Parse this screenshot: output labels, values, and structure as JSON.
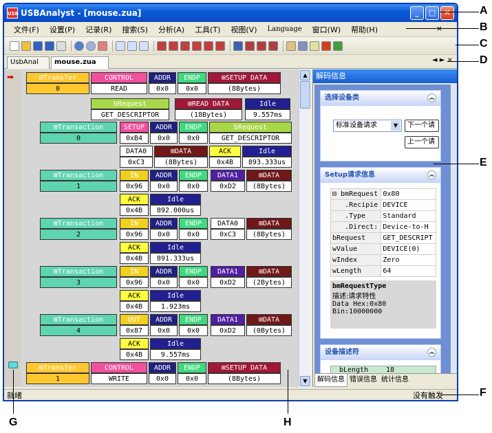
{
  "window": {
    "title": "USBAnalyst - [mouse.zua]",
    "logo": "USB"
  },
  "menu": [
    "文件(F)",
    "设置(P)",
    "记录(R)",
    "搜索(S)",
    "分析(A)",
    "工具(T)",
    "视图(V)",
    "Language",
    "窗口(W)",
    "帮助(H)"
  ],
  "menu_close": "×",
  "tabs": [
    "UsbAnal",
    "mouse.zua"
  ],
  "tab_nav": "◄ ► ×",
  "gutter": {
    "arrow": "➡"
  },
  "rows": [
    {
      "k": "t0_label",
      "text": "Transfer"
    },
    {
      "k": "t0_num",
      "text": "0"
    },
    {
      "k": "t0_ctrl",
      "text": "CONTROL"
    },
    {
      "k": "t0_read",
      "text": "READ"
    },
    {
      "k": "t0_addr",
      "text": "ADDR"
    },
    {
      "k": "t0_addr_v",
      "text": "0x0"
    },
    {
      "k": "t0_endp",
      "text": "ENDP"
    },
    {
      "k": "t0_endp_v",
      "text": "0x0"
    },
    {
      "k": "t0_setup",
      "text": "SETUP DATA"
    },
    {
      "k": "t0_setup_v",
      "text": "(8Bytes)"
    },
    {
      "k": "t0_breq",
      "text": "bRequest"
    },
    {
      "k": "t0_breq_v",
      "text": "GET_DESCRIPTOR"
    },
    {
      "k": "t0_rdata",
      "text": "READ DATA"
    },
    {
      "k": "t0_rdata_v",
      "text": "(18Bytes)"
    },
    {
      "k": "t0_idle",
      "text": "Idle"
    },
    {
      "k": "t0_idle_v",
      "text": "9.557ms"
    }
  ],
  "transactions": [
    {
      "name": "Transaction",
      "num": "0",
      "tok": "SETUP",
      "tok_v": "0xB4",
      "addr_v": "0x0",
      "endp_v": "0x0",
      "extra_h": "bRequest",
      "extra_v": "GET_DESCRIPTOR",
      "d_h": "DATA0",
      "d_v": "0xC3",
      "data_h": "DATA",
      "data_v": "(8Bytes)",
      "ack_v": "0x4B",
      "idle_v": "893.333us"
    },
    {
      "name": "Transaction",
      "num": "1",
      "tok": "IN",
      "tok_v": "0x96",
      "addr_v": "0x0",
      "endp_v": "0x0",
      "d_h": "DATA1",
      "d_v": "0xD2",
      "data_h": "DATA",
      "data_v": "(8Bytes)",
      "ack_v": "0x4B",
      "idle_v": "892.000us"
    },
    {
      "name": "Transaction",
      "num": "2",
      "tok": "IN",
      "tok_v": "0x96",
      "addr_v": "0x0",
      "endp_v": "0x0",
      "d_h": "DATA0",
      "d_v": "0xC3",
      "data_h": "DATA",
      "data_v": "(8Bytes)",
      "ack_v": "0x4B",
      "idle_v": "891.333us"
    },
    {
      "name": "Transaction",
      "num": "3",
      "tok": "IN",
      "tok_v": "0x96",
      "addr_v": "0x0",
      "endp_v": "0x0",
      "d_h": "DATA1",
      "d_v": "0xD2",
      "data_h": "DATA",
      "data_v": "(2Bytes)",
      "ack_v": "0x4B",
      "idle_v": "1.923ms"
    },
    {
      "name": "Transaction",
      "num": "4",
      "tok": "OUT",
      "tok_v": "0x87",
      "addr_v": "0x0",
      "endp_v": "0x0",
      "d_h": "DATA1",
      "d_v": "0xD2",
      "data_h": "DATA",
      "data_v": "(0Bytes)",
      "ack_v": "0x4B",
      "idle_v": "9.557ms"
    }
  ],
  "labels": {
    "addr": "ADDR",
    "endp": "ENDP",
    "ack": "ACK",
    "idle": "Idle"
  },
  "transfer1": {
    "label": "Transfer",
    "num": "1",
    "ctrl": "CONTROL",
    "dir": "WRITE",
    "addr_v": "0x0",
    "endp_v": "0x0",
    "setup": "SETUP DATA",
    "setup_v": "(8Bytes)"
  },
  "right_panel": {
    "title": "解码信息",
    "group1": {
      "title": "选择设备类",
      "select": "标准设备请求",
      "btn_next": "下一个请",
      "btn_prev": "上一个请"
    },
    "group2": {
      "title": "Setup请求信息",
      "rows": [
        [
          "⊟ bmRequest",
          "0x80"
        ],
        [
          "   .Recipie",
          "DEVICE"
        ],
        [
          "   .Type",
          "Standard"
        ],
        [
          "   .Direct:",
          "Device-to-H"
        ],
        [
          "bRequest",
          "GET_DESCRIPT"
        ],
        [
          "wValue",
          "DEVICE(0)"
        ],
        [
          "wIndex",
          "Zero"
        ],
        [
          "wLength",
          "64"
        ]
      ],
      "desc_title": "bmRequestType",
      "desc1": "描述:请求特性",
      "desc2": "Data Hex:0x80",
      "desc3": "Bin:10000000"
    },
    "group3": {
      "title": "设备描述符",
      "row_k": "bLength",
      "row_v": "18"
    },
    "tabs": [
      "解码信息",
      "错误信息",
      "统计信息"
    ]
  },
  "status": {
    "left": "就绪",
    "right": "没有触发"
  },
  "callouts": [
    "A",
    "B",
    "C",
    "D",
    "E",
    "F",
    "G",
    "H"
  ],
  "colors": {
    "transfer": "#ffc830",
    "transaction": "#5fd4b0",
    "control": "#f0509c",
    "addr": "#202080",
    "endp": "#40d880",
    "setup_data": "#a01838",
    "breq": "#a8d848",
    "idle": "#202090",
    "ack": "#ffff40",
    "tok": "#f0d020",
    "data_hdr": "#701818",
    "data1": "#5020a0"
  }
}
